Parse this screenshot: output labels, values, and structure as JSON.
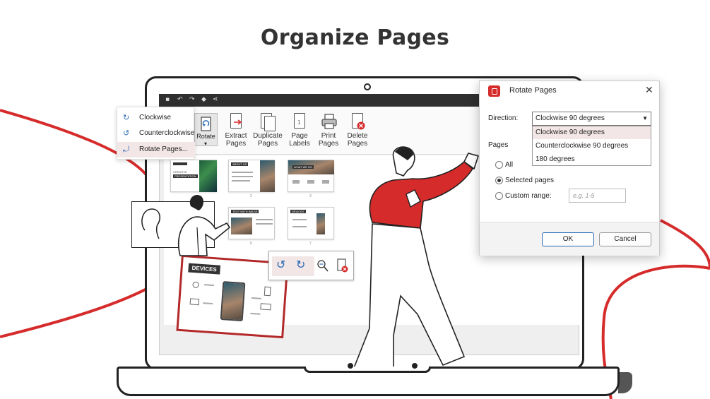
{
  "headline": "Organize Pages",
  "ribbon": {
    "rotate": "Rotate",
    "buttons": [
      {
        "label": "Extract Pages",
        "icon": "extract-pages-icon"
      },
      {
        "label": "Duplicate Pages",
        "icon": "duplicate-pages-icon"
      },
      {
        "label": "Page Labels",
        "icon": "page-labels-icon"
      },
      {
        "label": "Print Pages",
        "icon": "print-icon"
      },
      {
        "label": "Delete Pages",
        "icon": "delete-pages-icon"
      }
    ]
  },
  "rotate_menu": {
    "items": [
      {
        "label": "Clockwise",
        "icon": "rotate-clockwise-icon"
      },
      {
        "label": "Counterclockwise",
        "icon": "rotate-counterclockwise-icon"
      },
      {
        "label": "Rotate Pages...",
        "icon": "rotate-pages-icon",
        "selected": true
      }
    ]
  },
  "thumbnails": {
    "page_numbers": [
      "2",
      "3",
      "6",
      "7"
    ],
    "headers": [
      "CREATIVE",
      "PRESENTATION",
      "ABOUT US",
      "WHAT WE DO",
      "TEXT WITH IMAGE",
      "DEVICES"
    ]
  },
  "floating_card": {
    "title": "DEVICES"
  },
  "dialog": {
    "title": "Rotate Pages",
    "direction_label": "Direction:",
    "direction_value": "Clockwise 90 degrees",
    "direction_options": [
      "Clockwise 90 degrees",
      "Counterclockwise 90 degrees",
      "180 degrees"
    ],
    "pages_label": "Pages",
    "radio_all": "All",
    "radio_selected": "Selected pages",
    "radio_custom": "Custom range:",
    "custom_range_placeholder": "e.g. 1-5",
    "ok": "OK",
    "cancel": "Cancel",
    "accent": "#d62b2b"
  },
  "colors": {
    "brand_red": "#d62b2b",
    "accent_blue": "#2a6ab6"
  }
}
